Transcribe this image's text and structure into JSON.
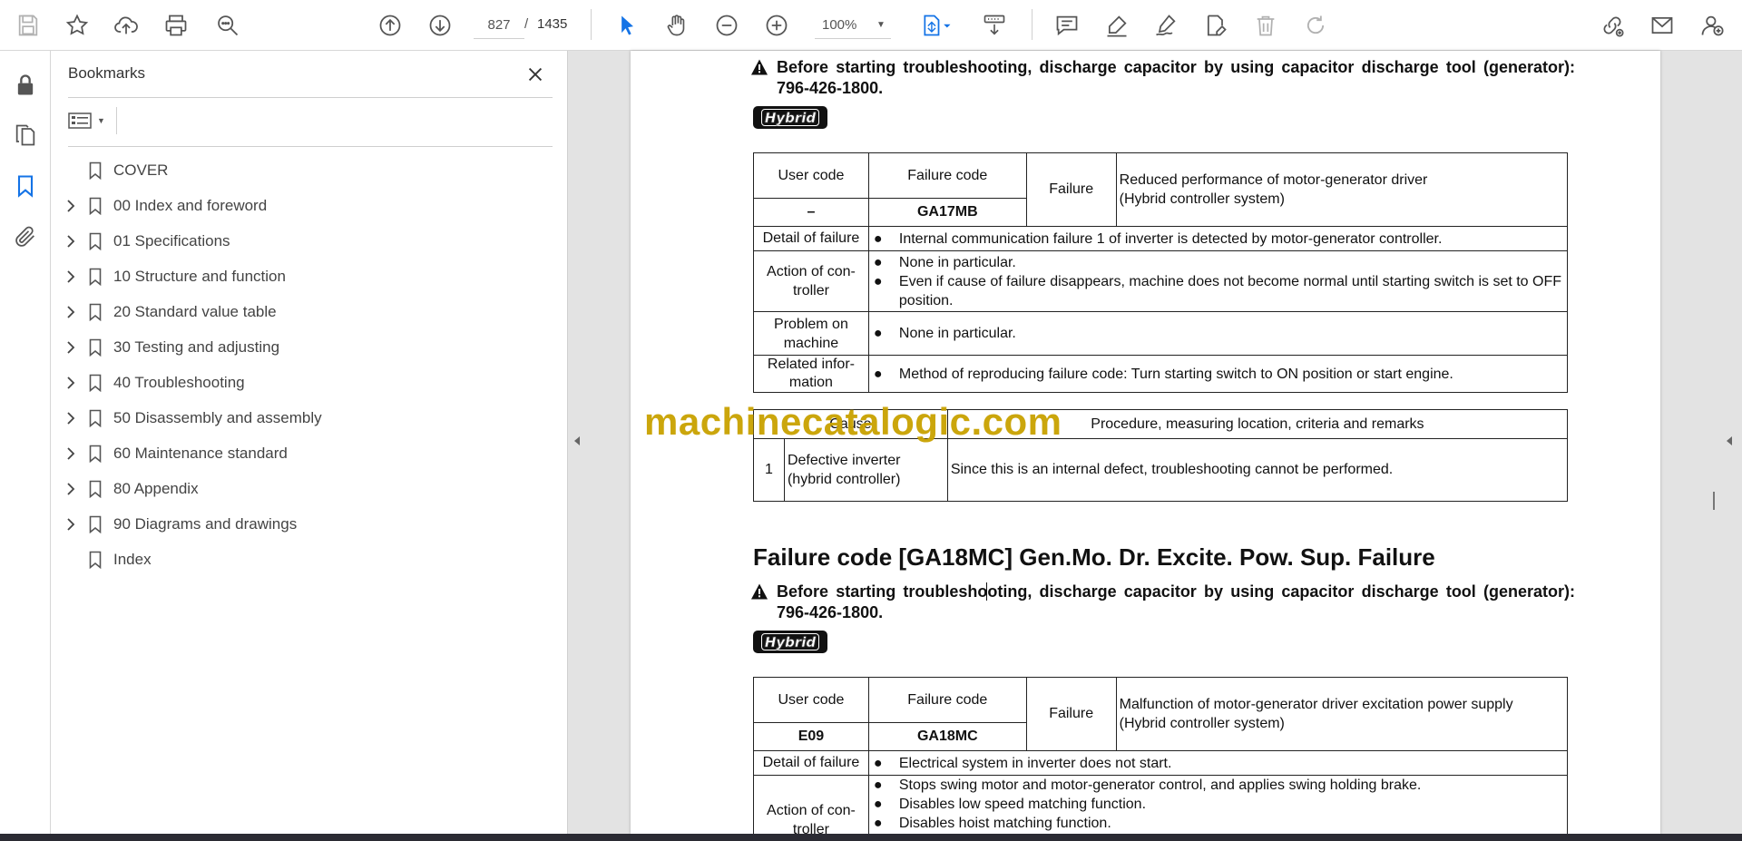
{
  "toolbar": {
    "page_current": "827",
    "page_separator": "/",
    "page_total": "1435",
    "zoom": "100%",
    "icons": [
      "save-icon",
      "bookmark-star-icon",
      "upload-icon",
      "print-icon",
      "search-zoom-icon",
      "page-up-icon",
      "page-down-icon",
      "select-cursor-icon",
      "hand-tool-icon",
      "zoom-out-icon",
      "zoom-in-icon",
      "page-fit-icon",
      "scroll-mode-icon",
      "comment-icon",
      "highlight-pen-icon",
      "draw-icon",
      "stamp-icon",
      "delete-icon",
      "redo-icon",
      "share-link-icon",
      "email-icon",
      "account-icon"
    ],
    "accent_color": "#1473e6"
  },
  "rail": {
    "icons": [
      "lock-icon",
      "pages-icon",
      "bookmarks-icon",
      "attachments-icon"
    ]
  },
  "bookmarks": {
    "title": "Bookmarks",
    "items": [
      {
        "label": "COVER",
        "expandable": false
      },
      {
        "label": "00 Index and foreword",
        "expandable": true
      },
      {
        "label": "01 Specifications",
        "expandable": true
      },
      {
        "label": "10 Structure and function",
        "expandable": true
      },
      {
        "label": "20 Standard value table",
        "expandable": true
      },
      {
        "label": "30 Testing and adjusting",
        "expandable": true
      },
      {
        "label": "40 Troubleshooting",
        "expandable": true
      },
      {
        "label": "50 Disassembly and assembly",
        "expandable": true
      },
      {
        "label": "60 Maintenance standard",
        "expandable": true
      },
      {
        "label": "80 Appendix",
        "expandable": true
      },
      {
        "label": "90 Diagrams and drawings",
        "expandable": true
      },
      {
        "label": "Index",
        "expandable": false
      }
    ]
  },
  "document": {
    "warning": "Before starting troubleshooting, discharge capacitor by using capacitor discharge tool (generator): 796-426-1800.",
    "hybrid_badge": "Hybrid",
    "watermark": "machinecatalogic.com",
    "table1": {
      "user_code_label": "User code",
      "failure_code_label": "Failure code",
      "failure_label": "Failure",
      "user_code": "–",
      "failure_code": "GA17MB",
      "failure_text_1": "Reduced performance of motor-generator driver",
      "failure_text_2": "(Hybrid controller system)",
      "detail_label": "Detail of failure",
      "detail": "Internal communication failure 1 of inverter is detected by motor-generator controller.",
      "action_label_1": "Action of con-",
      "action_label_2": "troller",
      "action_1": "None in particular.",
      "action_2": "Even if cause of failure disappears, machine does not become normal until starting switch is set to OFF position.",
      "problem_label_1": "Problem on",
      "problem_label_2": "machine",
      "problem": "None in particular.",
      "related_label_1": "Related infor-",
      "related_label_2": "mation",
      "related": "Method of reproducing failure code: Turn starting switch to ON position or start engine."
    },
    "cause_table": {
      "cause_header": "Cause",
      "procedure_header": "Procedure, measuring location, criteria and remarks",
      "row_no": "1",
      "cause_1": "Defective inverter",
      "cause_2": "(hybrid controller)",
      "procedure": "Since this is an internal defect, troubleshooting cannot be performed."
    },
    "section2_title": "Failure code [GA18MC] Gen.Mo. Dr. Excite. Pow. Sup. Failure",
    "table2": {
      "user_code": "E09",
      "failure_code": "GA18MC",
      "failure_text_1": "Malfunction of motor-generator driver excitation power supply",
      "failure_text_2": "(Hybrid controller system)",
      "detail": "Electrical system in inverter does not start.",
      "action_1": "Stops swing motor and motor-generator control, and applies swing holding brake.",
      "action_2": "Disables low speed matching function.",
      "action_3": "Disables hoist matching function."
    }
  }
}
